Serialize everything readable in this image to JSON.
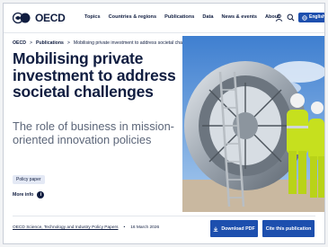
{
  "header": {
    "logo_text": "OECD",
    "nav": [
      "Topics",
      "Countries & regions",
      "Publications",
      "Data",
      "News & events",
      "About"
    ],
    "language_label": "English"
  },
  "breadcrumb": [
    "OECD",
    "Publications"
  ],
  "page_title": "Mobilising private investment to address societal challenges",
  "subtitle": "The role of business in mission-oriented innovation policies",
  "badge": "Policy paper",
  "more_info": "More info",
  "series": {
    "name": "OECD Science, Technology and Industry Policy Papers",
    "date": "16 March 2026"
  },
  "actions": {
    "download": "Download PDF",
    "cite": "Cite this publication"
  },
  "colors": {
    "brand_navy": "#101d40",
    "accent_blue": "#1d4fae"
  }
}
